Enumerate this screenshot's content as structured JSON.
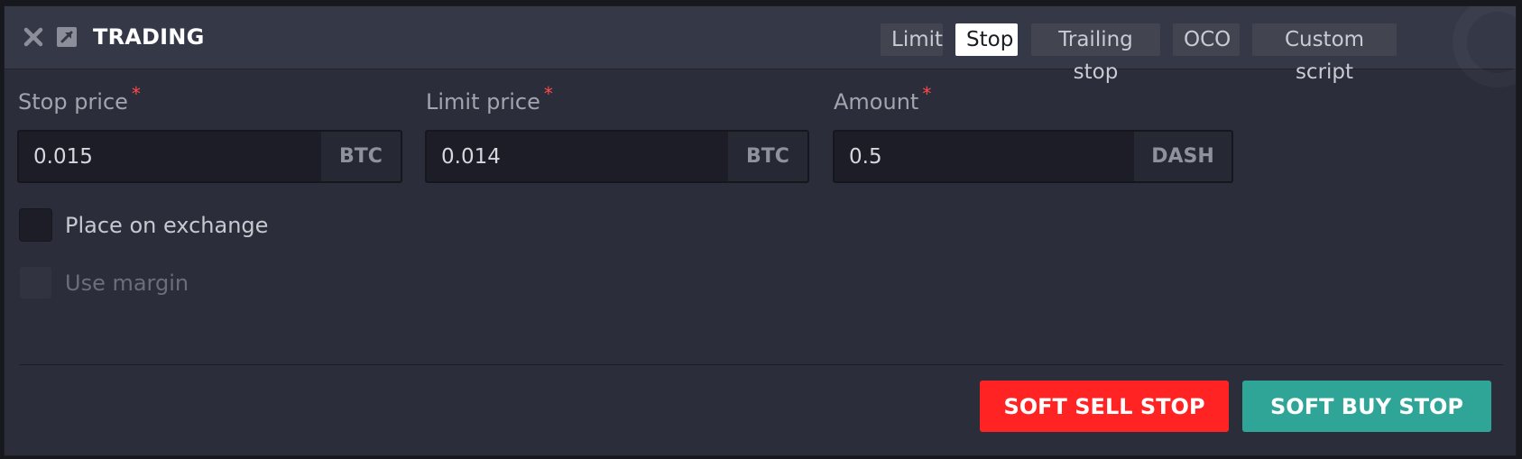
{
  "header": {
    "title": "TRADING",
    "close_icon": "close-icon",
    "popout_icon": "popout-icon",
    "tabs": [
      {
        "label": "Limit",
        "active": false
      },
      {
        "label": "Stop",
        "active": true
      },
      {
        "label": "Trailing stop",
        "active": false
      },
      {
        "label": "OCO",
        "active": false
      },
      {
        "label": "Custom script",
        "active": false
      }
    ]
  },
  "form": {
    "stop_price": {
      "label": "Stop price",
      "required": "*",
      "value": "0.015",
      "unit": "BTC"
    },
    "limit_price": {
      "label": "Limit price",
      "required": "*",
      "value": "0.014",
      "unit": "BTC"
    },
    "amount": {
      "label": "Amount",
      "required": "*",
      "value": "0.5",
      "unit": "DASH"
    },
    "place_on_exchange": {
      "label": "Place on exchange",
      "checked": false
    },
    "use_margin": {
      "label": "Use margin",
      "checked": false,
      "disabled": true
    }
  },
  "actions": {
    "sell_label": "SOFT SELL STOP",
    "buy_label": "SOFT BUY STOP"
  },
  "colors": {
    "sell": "#ff2323",
    "buy": "#2ea597",
    "required_marker": "#ff4a4a",
    "panel": "#2b2d3a",
    "header": "#353847"
  }
}
